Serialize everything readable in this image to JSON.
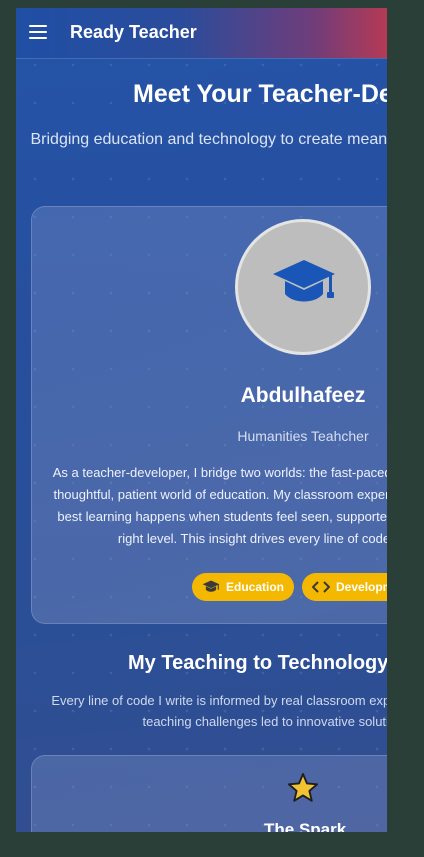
{
  "appbar": {
    "title": "Ready Teacher",
    "menu_icon": "menu-icon"
  },
  "hero": {
    "heading": "Meet Your Teacher-Developer",
    "subtitle": "Bridging education and technology to create meaningful learning experiences"
  },
  "profile": {
    "avatar_icon": "graduation-cap-icon",
    "name": "Abdulhafeez",
    "role": "Humanities Teahcher",
    "bio": "As a teacher-developer, I bridge two worlds: the fast-paced world of technology and the thoughtful, patient world of education. My classroom experience has taught me that the best learning happens when students feel seen, supported, and challenged at just the right level. This insight drives every line of code I write and every",
    "tags": [
      {
        "label": "Education",
        "icon": "graduation-cap-icon"
      },
      {
        "label": "Development",
        "icon": "code-icon"
      }
    ]
  },
  "journey": {
    "heading": "My Teaching to Technology Journey",
    "subtitle": "Every line of code I write is informed by real classroom experience. Here's how teaching challenges led to innovative solutions.",
    "cards": [
      {
        "icon": "star-icon",
        "title": "The Spark"
      }
    ]
  },
  "colors": {
    "accent": "#f5b800",
    "appbar_start": "#1f4fa5",
    "appbar_end": "#b53a55",
    "cap_blue": "#1a56b8"
  }
}
